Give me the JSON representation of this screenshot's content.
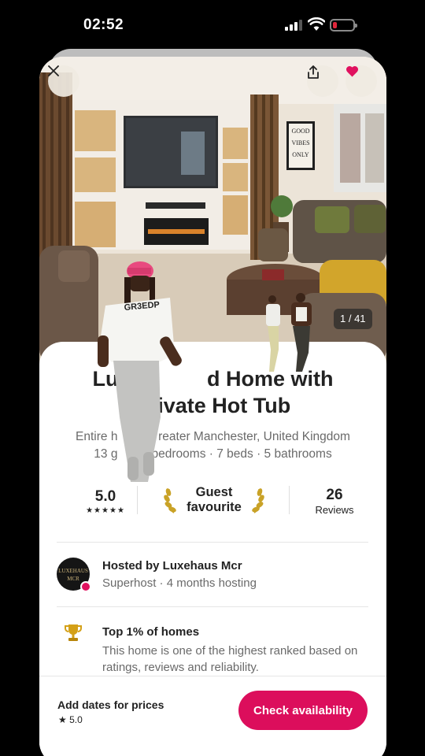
{
  "status_bar": {
    "time": "02:52"
  },
  "listing": {
    "photo_counter": "1 / 41",
    "title": "Luxe           d Home with Private Hot Tub",
    "subtitle": "Entire h            reater Manchester, United Kingdom",
    "details": "13 g          bedrooms · 7 beds · 5 bathrooms"
  },
  "stats": {
    "rating": "5.0",
    "stars": "★★★★★",
    "guest_favourite": "Guest favourite",
    "reviews_count": "26",
    "reviews_label": "Reviews"
  },
  "host": {
    "avatar_text": "LUXEHAUS MCR",
    "name": "Hosted by Luxehaus Mcr",
    "meta": "Superhost · 4 months hosting"
  },
  "highlight": {
    "title": "Top 1% of homes",
    "description": "This home is one of the highest ranked based on ratings, reviews and reliability."
  },
  "footer": {
    "price_text": "Add dates for prices",
    "rating": "★ 5.0",
    "cta_label": "Check availability"
  },
  "photo_sign": "GOOD VIBES ONLY",
  "shirt_text": "GR3EDP",
  "icons": [
    "close-icon",
    "share-icon",
    "heart-icon",
    "laurel-icon",
    "trophy-icon"
  ],
  "colors": {
    "brand": "#dc0e5c",
    "heart": "#e0115f",
    "text": "#222222",
    "muted": "#6a6a6a"
  }
}
